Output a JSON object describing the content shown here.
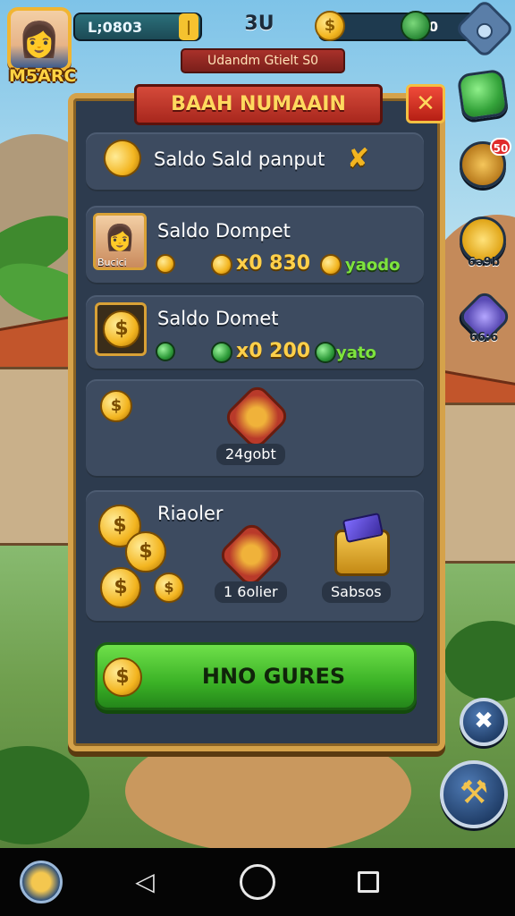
{
  "hud": {
    "player_name": "M5ARC",
    "left_resource": "L;0803",
    "level": "3U",
    "right_resource": "0",
    "banner": "Udandm Gtielt S0"
  },
  "side": {
    "badge": "50",
    "coin_label": "6ǝ9b",
    "gem_label": "66:6"
  },
  "panel": {
    "title": "BAAH NUMAAIN",
    "close_label": "✕",
    "row1": {
      "label": "Saldo Sald panput"
    },
    "row2": {
      "label": "Saldo Dompet",
      "portrait_name": "Bucici",
      "amount": "x0 830",
      "suffix": "yaodo"
    },
    "row3": {
      "label": "Saldo Domet",
      "amount": "x0 200",
      "suffix": "yato"
    },
    "row4": {
      "pill": "24gobt"
    },
    "row5": {
      "label": "Riaoler",
      "item1": "1 6olier",
      "item2": "Sabsos"
    },
    "cta": "HNO GURES"
  },
  "colors": {
    "panel_bg": "#2d3b4e",
    "panel_border": "#d5a24a",
    "cta_green": "#3bb226",
    "title_red": "#a8271d",
    "coin_gold": "#f3b520",
    "accent_green": "#7ee43d"
  },
  "icons": {
    "top_right": "settings-gear-icon",
    "side": [
      "green-gem-icon",
      "treasure-chest-icon",
      "gold-coin-icon",
      "purple-gem-icon"
    ],
    "tools": [
      "close-x-icon",
      "hammer-icon"
    ],
    "nav": [
      "back-triangle-icon",
      "home-circle-icon",
      "recent-square-icon"
    ]
  }
}
